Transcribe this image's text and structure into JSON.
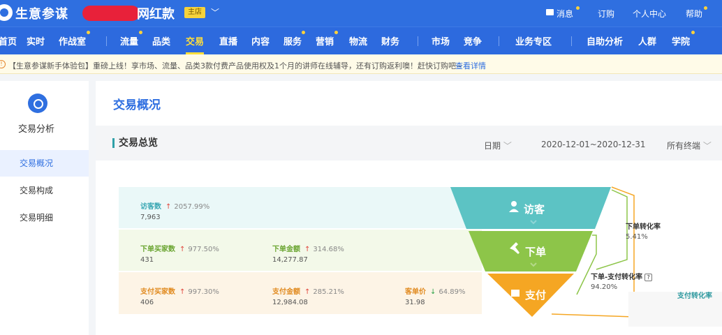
{
  "header": {
    "brand": "生意参谋",
    "store_name_visible": "网红款",
    "store_badge": "主店",
    "right_links": [
      "消息",
      "订购",
      "个人中心",
      "帮助"
    ]
  },
  "nav": {
    "items": [
      "首页",
      "实时",
      "作战室",
      "流量",
      "品类",
      "交易",
      "直播",
      "内容",
      "服务",
      "营销",
      "物流",
      "财务",
      "市场",
      "竞争",
      "业务专区",
      "自助分析",
      "人群",
      "学院"
    ],
    "active": "交易"
  },
  "notice": {
    "icon": "!",
    "text": "【生意参谋新手体验包】重磅上线！享市场、流量、品类3款付费产品使用权及1个月的讲师在线辅导，还有订购返利噢！赶快订购吧~",
    "link": "查看详情"
  },
  "sidebar": {
    "title": "交易分析",
    "items": [
      "交易概况",
      "交易构成",
      "交易明细"
    ],
    "active_index": 0
  },
  "main": {
    "page_title": "交易概况",
    "section_title": "交易总览",
    "date_label": "日期",
    "date_range": "2020-12-01~2020-12-31",
    "terminal": "所有终端"
  },
  "metrics": {
    "visitors": {
      "label": "访客数",
      "change": "2057.99%",
      "value": "7,963"
    },
    "order_buyers": {
      "label": "下单买家数",
      "change": "977.50%",
      "value": "431"
    },
    "order_amount": {
      "label": "下单金额",
      "change": "314.68%",
      "value": "14,277.87"
    },
    "pay_buyers": {
      "label": "支付买家数",
      "change": "997.30%",
      "value": "406"
    },
    "pay_amount": {
      "label": "支付金额",
      "change": "285.21%",
      "value": "12,984.08"
    },
    "unit_price": {
      "label": "客单价",
      "change": "64.89%",
      "value": "31.98"
    }
  },
  "funnel": {
    "stages": [
      "访客",
      "下单",
      "支付"
    ],
    "colors": {
      "visit": "#5cc3c4",
      "order": "#8dc549",
      "pay": "#f5a623",
      "visit_band": "#eaf8f8",
      "order_band": "#f3f9e9",
      "pay_band": "#fdf4e6"
    },
    "conversions": [
      {
        "label": "下单转化率",
        "value": "5.41%"
      },
      {
        "label": "下单-支付转化率",
        "value": "94.20%"
      },
      {
        "label": "支付转化率",
        "value": ""
      }
    ]
  },
  "icons": {
    "up": "▲",
    "down": "▼",
    "chevron": "﹀",
    "question": "?"
  }
}
